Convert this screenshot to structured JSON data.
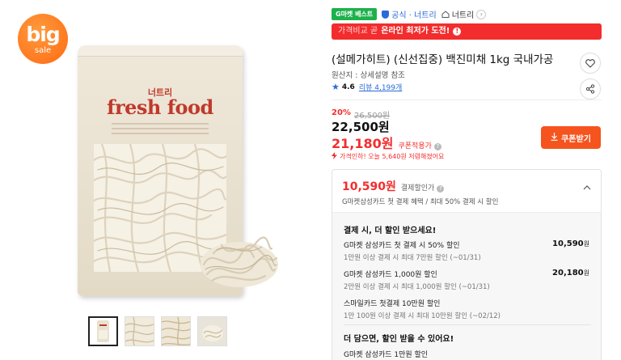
{
  "gallery": {
    "badge_big": "big",
    "badge_sale": "sale",
    "bag_brand": "너트리",
    "bag_title": "fresh food",
    "thumbnails": [
      "thumbnail-1",
      "thumbnail-2",
      "thumbnail-3",
      "thumbnail-4"
    ]
  },
  "badges": {
    "best": "G마켓 베스트",
    "official": "공식 · 너트리",
    "store": "너트리",
    "store_icon": "home-icon",
    "official_icon": "shield-icon"
  },
  "promo": {
    "prefix": "가격비교 곧",
    "highlight": "온라인 최저가 도전!",
    "info": "!"
  },
  "product": {
    "title": "(설메가히트) (신선집중) 백진미채 1kg 국내가공",
    "origin": "원산지 : 상세설명 참조",
    "rating": "4.6",
    "review_label": "리뷰 4,199개",
    "discount_pct": "20%",
    "original_price": "26,500원",
    "price": "22,500원",
    "coupon_price": "21,180원",
    "coupon_price_label": "쿠폰적용가",
    "shipping_note": "가격인하! 오늘 5,640원 저렴해졌어요",
    "coupon_button": "쿠폰받기"
  },
  "card": {
    "price": "10,590원",
    "price_label": "결제할인가",
    "subtitle": "G마켓삼성카드 첫 결제 혜택 / 최대 50% 결제 시 할인",
    "section1_title": "결제 시, 더 할인 받으세요!",
    "rows": [
      {
        "label": "G마켓 삼성카드 첫 결제 시 50% 할인",
        "sub": "1만원 이상 결제 시 최대 7만원 할인 (~01/31)",
        "amount": "10,590",
        "unit": "원"
      },
      {
        "label": "G마켓 삼성카드 1,000원 할인",
        "sub": "2만원 이상 결제 시 최대 1,000원 할인 (~01/31)",
        "amount": "20,180",
        "unit": "원"
      },
      {
        "label": "스마일카드 첫결제 10만원 할인",
        "sub": "1만 100원 이상 결제 시 최대 10만원 할인 (~02/12)",
        "amount": "",
        "unit": ""
      }
    ],
    "section2_title": "더 담으면, 할인 받을 수 있어요!",
    "section2_row": "G마켓 삼성카드 1만원 할인"
  },
  "colors": {
    "accent_red": "#f32d2d",
    "coupon_orange": "#f5541e",
    "best_green": "#1db14c",
    "official_blue": "#2a6bd7"
  }
}
